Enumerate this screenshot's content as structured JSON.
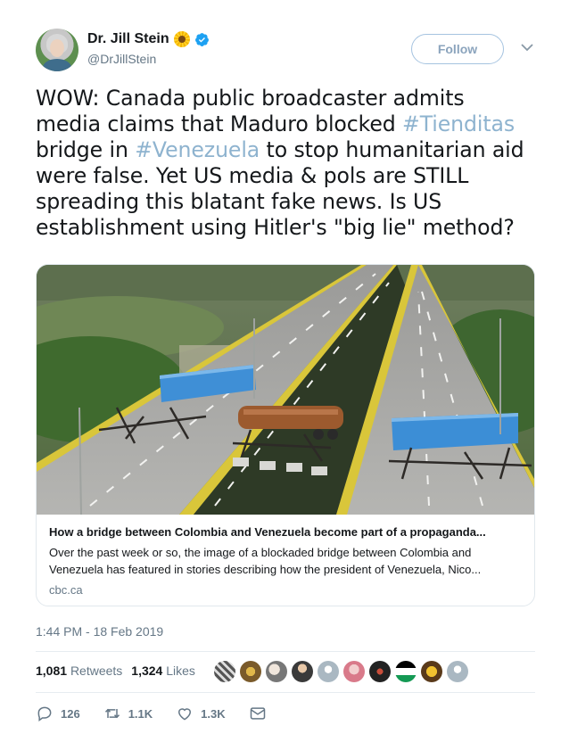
{
  "author": {
    "display_name": "Dr. Jill Stein",
    "emoji": "sunflower",
    "verified": true,
    "handle": "@DrJillStein"
  },
  "follow_label": "Follow",
  "tweet": {
    "t1": "WOW: Canada public broadcaster admits media claims that Maduro blocked ",
    "hashtag1": "#Tienditas",
    "t2": " bridge in ",
    "hashtag2": "#Venezuela",
    "t3": " to stop humanitarian aid were false. Yet US media & pols are STILL spreading this blatant fake news. Is US establishment using Hitler's \"big lie\" method?"
  },
  "card": {
    "title": "How a bridge between Colombia and Venezuela become part of a propaganda...",
    "description": "Over the past week or so, the image of a blockaded bridge between Colombia and Venezuela has featured in stories describing how the president of Venezuela, Nico...",
    "domain": "cbc.ca"
  },
  "timestamp": "1:44 PM - 18 Feb 2019",
  "stats": {
    "retweets_count": "1,081",
    "retweets_label": "Retweets",
    "likes_count": "1,324",
    "likes_label": "Likes"
  },
  "actions": {
    "replies": "126",
    "retweets": "1.1K",
    "likes": "1.3K"
  },
  "colors": {
    "accent": "#1da1f2",
    "hashtag": "#8eb3cf",
    "muted": "#657786",
    "text": "#14171a"
  }
}
